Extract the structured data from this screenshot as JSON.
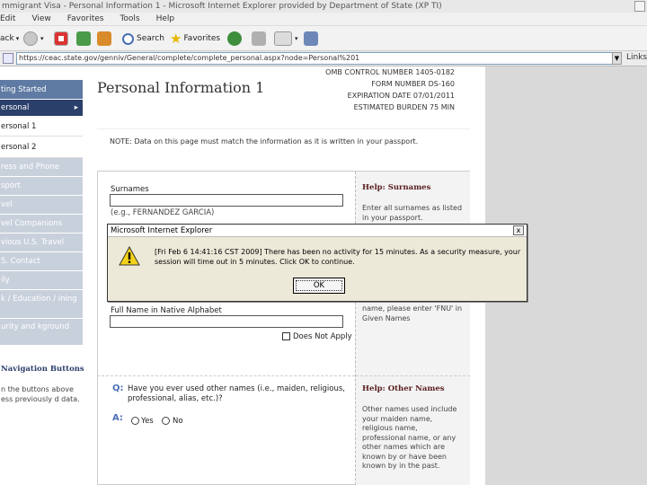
{
  "window": {
    "title": "mmigrant Visa - Personal Information 1 - Microsoft Internet Explorer provided by Department of State (XP TI)"
  },
  "menu": [
    "Edit",
    "View",
    "Favorites",
    "Tools",
    "Help"
  ],
  "toolbar": {
    "back": "ack",
    "search": "Search",
    "favorites": "Favorites"
  },
  "address": {
    "url": "https://ceac.state.gov/genniv/General/complete/complete_personal.aspx?node=Personal%201",
    "links": "Links"
  },
  "sidebar": {
    "items": [
      {
        "label": "ting Started"
      },
      {
        "label": "ersonal"
      },
      {
        "label": "ersonal 1"
      },
      {
        "label": "ersonal 2"
      },
      {
        "label": "ress and Phone"
      },
      {
        "label": "sport"
      },
      {
        "label": "vel"
      },
      {
        "label": "vel Companions"
      },
      {
        "label": "vious U.S. Travel"
      },
      {
        "label": "S. Contact"
      },
      {
        "label": "ily"
      },
      {
        "label": "k / Education / ining"
      },
      {
        "label": "urity and kground"
      }
    ],
    "nav_buttons_title": "Navigation Buttons",
    "nav_buttons_text": "n the buttons above ess previously d data.",
    "expand_marker": "▸"
  },
  "header": {
    "page_title": "Personal Information 1",
    "omb": {
      "control_label": "OMB CONTROL NUMBER",
      "control_value": "1405-0182",
      "form_label": "FORM NUMBER",
      "form_value": "DS-160",
      "expiry_label": "EXPIRATION DATE",
      "expiry_value": "07/01/2011",
      "burden_label": "ESTIMATED BURDEN",
      "burden_value": "75 MIN"
    }
  },
  "note": "NOTE: Data on this page must match the information as it is written in your passport.",
  "form": {
    "surnames_label": "Surnames",
    "surnames_example": "(e.g., FERNANDEZ GARCIA)",
    "native_name_label": "Full Name in Native Alphabet",
    "does_not_apply": "Does Not Apply",
    "q_marker": "Q:",
    "question": "Have you ever used other names (i.e., maiden, religious, professional, alias, etc.)?",
    "a_marker": "A:",
    "yes": "Yes",
    "no": "No"
  },
  "help": {
    "surnames_title": "Help: Surnames",
    "surnames_text": "Enter all surnames as listed in your passport.",
    "given_text": "name, please enter 'FNU' in Given Names",
    "other_title": "Help: Other Names",
    "other_text": "Other names used include your maiden name, religious name, professional name, or any other names which are known by or have been known by in the past."
  },
  "dialog": {
    "title": "Microsoft Internet Explorer",
    "message": "[Fri Feb 6 14:41:16 CST 2009] There has been no activity for 15 minutes. As a security measure, your session will time out in 5 minutes. Click OK to continue.",
    "ok": "OK",
    "close": "x"
  }
}
